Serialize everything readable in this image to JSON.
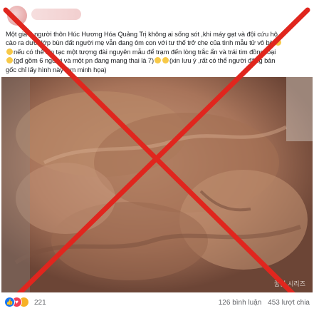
{
  "post": {
    "caption_lines": [
      "Một gia 9 người thôn Húc Hương Hóa Quảng Trị không ai sống sót ,khi máy gạt và đội cứu hộ",
      "cào ra dưới lớp bùn đất người mẹ vẫn đang ôm con với tư thế trở che của tình mẫu tử vô bờ",
      "nếu có thể xin tạc một tượng đài nguyên mẫu để trạm đến lòng trắc ẩn và trái tim đồng loại",
      "(gđ gồm 6 người và một pn đang mang thai là 7)",
      "(xin lưu ý ,rất có thể người đăng bản",
      "gốc chỉ lấy hình này làm minh họa)"
    ],
    "watermark": "꿈원 시리즈",
    "overlay_color": "#e0261e"
  },
  "footer": {
    "reaction_icons": [
      "like-icon",
      "love-icon",
      "sad-icon"
    ],
    "reaction_count": "221",
    "comments": "126 bình luận",
    "shares": "453 lượt chia"
  }
}
